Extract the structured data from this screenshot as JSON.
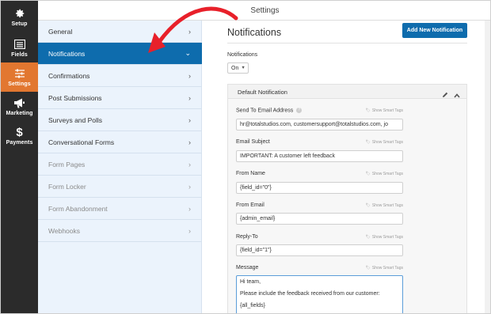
{
  "header": {
    "title": "Settings"
  },
  "rail": [
    {
      "label": "Setup",
      "icon": "gear-icon"
    },
    {
      "label": "Fields",
      "icon": "fields-list-icon"
    },
    {
      "label": "Settings",
      "icon": "sliders-icon",
      "active": true
    },
    {
      "label": "Marketing",
      "icon": "megaphone-icon"
    },
    {
      "label": "Payments",
      "icon": "dollar-icon"
    }
  ],
  "subnav": [
    {
      "label": "General"
    },
    {
      "label": "Notifications",
      "active": true
    },
    {
      "label": "Confirmations"
    },
    {
      "label": "Post Submissions"
    },
    {
      "label": "Surveys and Polls"
    },
    {
      "label": "Conversational Forms"
    },
    {
      "label": "Form Pages",
      "muted": true
    },
    {
      "label": "Form Locker",
      "muted": true
    },
    {
      "label": "Form Abandonment",
      "muted": true
    },
    {
      "label": "Webhooks",
      "muted": true
    }
  ],
  "main": {
    "title": "Notifications",
    "add_button": "Add New Notification",
    "notifications_label": "Notifications",
    "notifications_value": "On",
    "box_title": "Default Notification",
    "smart_tags": "Show Smart Tags",
    "fields": {
      "send_to_label": "Send To Email Address",
      "send_to_value": "hr@totalstudios.com, customersupport@totalstudios.com, jo",
      "subject_label": "Email Subject",
      "subject_value": "IMPORTANT: A customer left feedback",
      "from_name_label": "From Name",
      "from_name_value": "{field_id=\"0\"}",
      "from_email_label": "From Email",
      "from_email_value": "{admin_email}",
      "reply_to_label": "Reply-To",
      "reply_to_value": "{field_id=\"1\"}",
      "message_label": "Message",
      "message_lines": [
        "Hi team,",
        "Please include the feedback received from our customer:",
        "{all_fields}"
      ]
    }
  },
  "colors": {
    "accent": "#0e6cad",
    "rail": "#2b2b2b",
    "rail_active": "#e27730",
    "arrow": "#e8202a"
  }
}
